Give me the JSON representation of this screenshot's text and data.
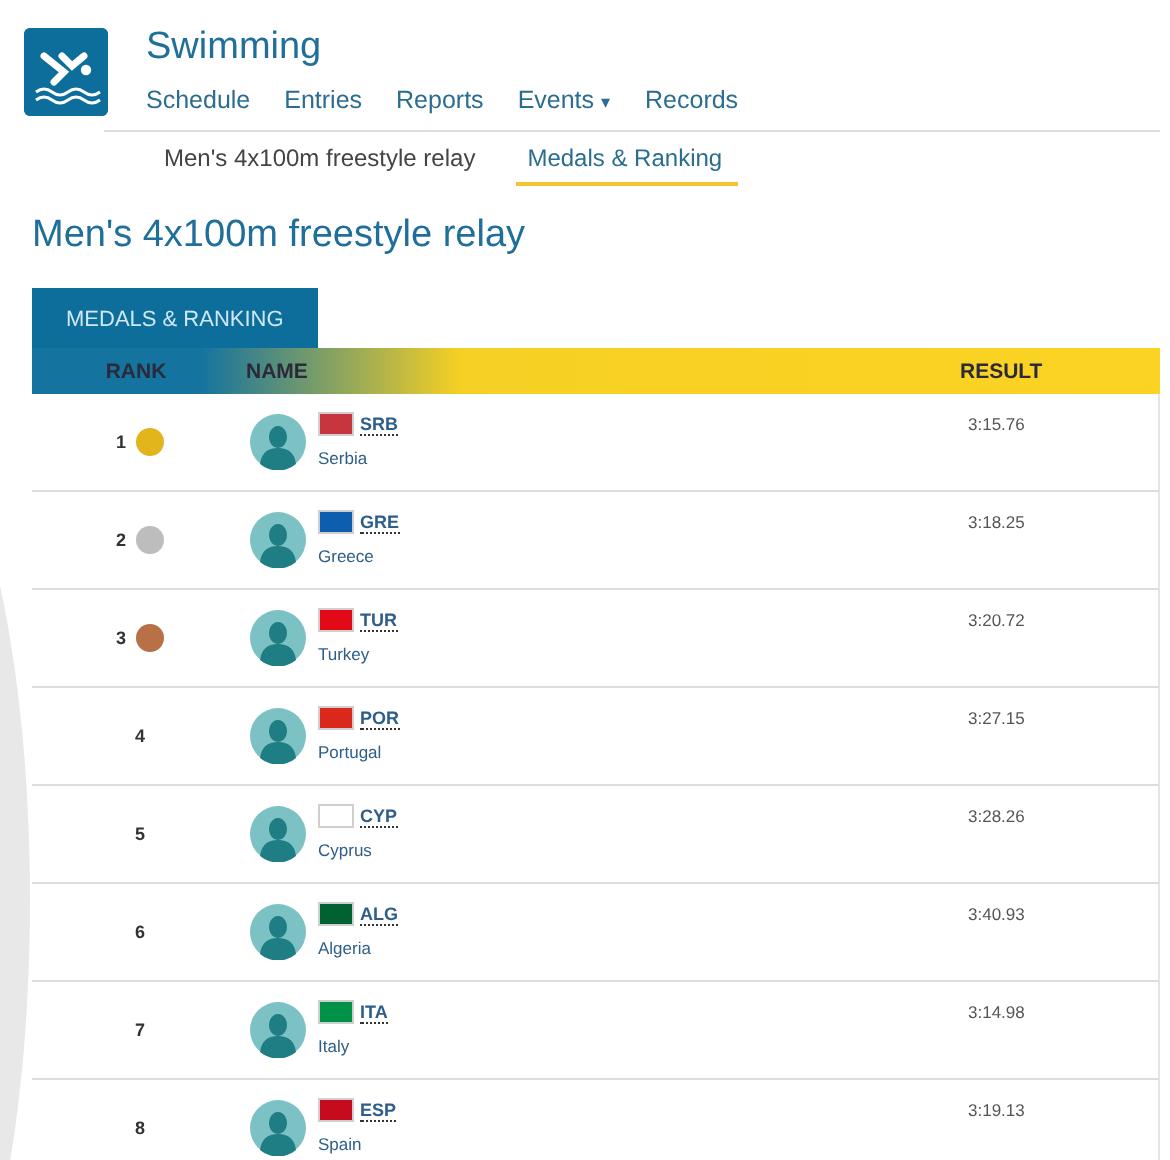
{
  "header": {
    "title": "Swimming",
    "nav": [
      {
        "label": "Schedule"
      },
      {
        "label": "Entries"
      },
      {
        "label": "Reports"
      },
      {
        "label": "Events",
        "caret": "▾"
      },
      {
        "label": "Records"
      }
    ]
  },
  "subtabs": [
    {
      "label": "Men's 4x100m freestyle relay",
      "selected": false
    },
    {
      "label": "Medals & Ranking",
      "selected": true
    }
  ],
  "heading": "Men's 4x100m freestyle relay",
  "panel_tab": "MEDALS & RANKING",
  "table": {
    "columns": [
      "RANK",
      "NAME",
      "RESULT"
    ],
    "rows": [
      {
        "rank": "1",
        "medal": {
          "color": "#e3b51c"
        },
        "code": "SRB",
        "country": "Serbia",
        "result": "3:15.76",
        "flag": {
          "color": "#c6363c"
        }
      },
      {
        "rank": "2",
        "medal": {
          "color": "#bdbdbd"
        },
        "code": "GRE",
        "country": "Greece",
        "result": "3:18.25",
        "flag": {
          "color": "#0d5eaf"
        }
      },
      {
        "rank": "3",
        "medal": {
          "color": "#b87046"
        },
        "code": "TUR",
        "country": "Turkey",
        "result": "3:20.72",
        "flag": {
          "color": "#e30a17"
        }
      },
      {
        "rank": "4",
        "code": "POR",
        "country": "Portugal",
        "result": "3:27.15",
        "flag": {
          "color": "#da291c"
        }
      },
      {
        "rank": "5",
        "code": "CYP",
        "country": "Cyprus",
        "result": "3:28.26",
        "flag": {
          "color": "#ffffff"
        }
      },
      {
        "rank": "6",
        "code": "ALG",
        "country": "Algeria",
        "result": "3:40.93",
        "flag": {
          "color": "#006233"
        }
      },
      {
        "rank": "7",
        "code": "ITA",
        "country": "Italy",
        "result": "3:14.98",
        "flag": {
          "color": "#009246"
        }
      },
      {
        "rank": "8",
        "code": "ESP",
        "country": "Spain",
        "result": "3:19.13",
        "flag": {
          "color": "#c60b1e"
        }
      }
    ]
  }
}
